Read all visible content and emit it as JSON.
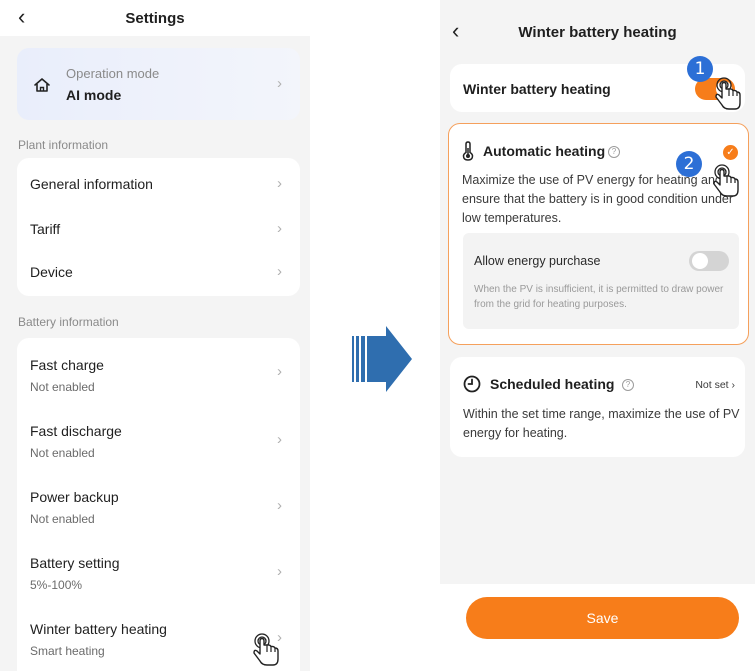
{
  "left": {
    "title": "Settings",
    "mode": {
      "label": "Operation mode",
      "value": "AI mode"
    },
    "plant_section": "Plant information",
    "plant_items": [
      {
        "label": "General information"
      },
      {
        "label": "Tariff"
      },
      {
        "label": "Device"
      }
    ],
    "battery_section": "Battery information",
    "battery_items": [
      {
        "label": "Fast charge",
        "sub": "Not enabled"
      },
      {
        "label": "Fast discharge",
        "sub": "Not enabled"
      },
      {
        "label": "Power backup",
        "sub": "Not enabled"
      },
      {
        "label": "Battery setting",
        "sub": "5%-100%"
      },
      {
        "label": "Winter battery heating",
        "sub": "Smart heating"
      }
    ]
  },
  "right": {
    "title": "Winter battery heating",
    "toggle_label": "Winter battery heating",
    "toggle_on": true,
    "auto": {
      "title": "Automatic heating",
      "selected": true,
      "description": "Maximize the use of PV energy for heating and ensure that the battery is in good condition under low temperatures.",
      "purchase_label": "Allow energy purchase",
      "purchase_enabled": false,
      "purchase_description": "When the PV is insufficient, it is permitted to draw power from the grid for heating purposes."
    },
    "scheduled": {
      "title": "Scheduled heating",
      "status": "Not set",
      "description": "Within the set time range, maximize the use of PV energy for heating."
    },
    "save_label": "Save"
  },
  "badges": [
    "1",
    "2"
  ],
  "colors": {
    "accent": "#f77d1a",
    "badge": "#2c6fd6",
    "arrow": "#2f6eaf"
  }
}
